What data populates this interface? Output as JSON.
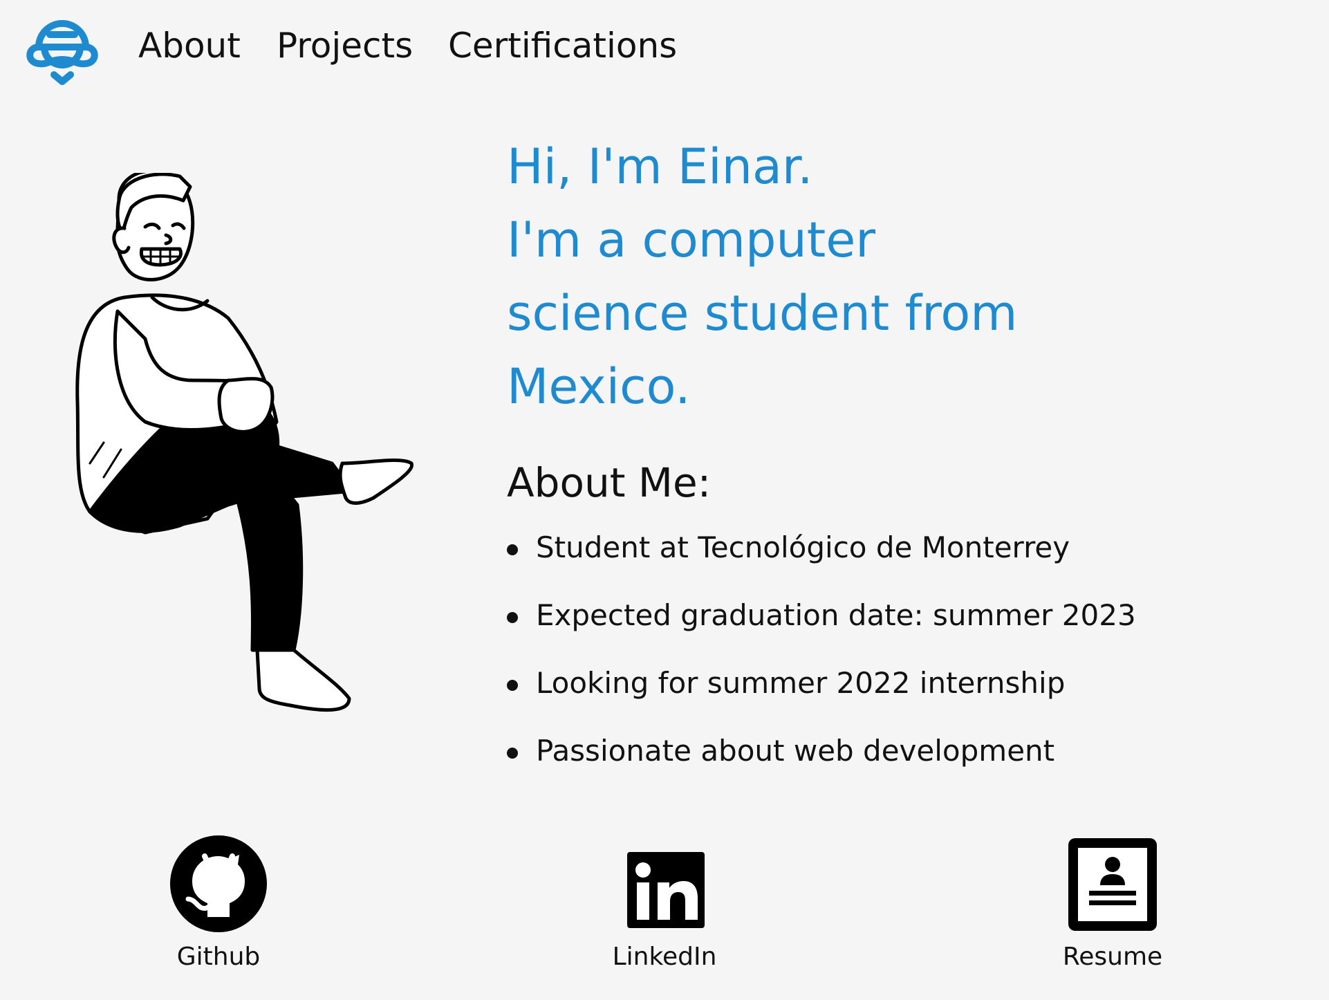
{
  "nav": {
    "logo_icon": "robot-logo-icon",
    "accent_color": "#1e8ad0",
    "links": [
      {
        "label": "About"
      },
      {
        "label": "Projects"
      },
      {
        "label": "Certifications"
      }
    ]
  },
  "hero": {
    "lines": [
      "Hi, I'm Einar.",
      "I'm a computer",
      "science student from",
      "Mexico."
    ],
    "color": "#1e8ad0"
  },
  "about": {
    "title": "About Me:",
    "items": [
      "Student at Tecnológico de Monterrey",
      "Expected graduation date: summer 2023",
      "Looking for summer 2022 internship",
      "Passionate about web development"
    ]
  },
  "social": [
    {
      "label": "Github",
      "icon": "github-icon"
    },
    {
      "label": "LinkedIn",
      "icon": "linkedin-icon"
    },
    {
      "label": "Resume",
      "icon": "resume-icon"
    }
  ],
  "illustration": {
    "icon": "sitting-person-illustration"
  }
}
